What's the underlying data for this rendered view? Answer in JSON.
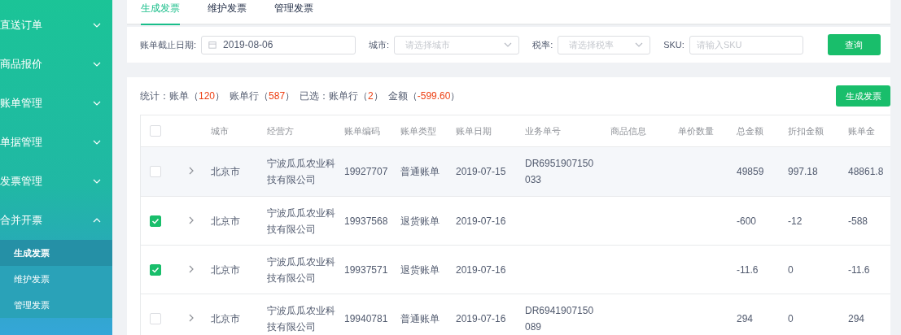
{
  "sidebar": {
    "items": [
      {
        "label": "直送订单",
        "expanded": false
      },
      {
        "label": "商品报价",
        "expanded": false
      },
      {
        "label": "账单管理",
        "expanded": false
      },
      {
        "label": "单据管理",
        "expanded": false
      },
      {
        "label": "发票管理",
        "expanded": false
      },
      {
        "label": "合并开票",
        "expanded": true,
        "children": [
          {
            "label": "生成发票",
            "selected": true
          },
          {
            "label": "维护发票",
            "selected": false
          },
          {
            "label": "管理发票",
            "selected": false
          }
        ]
      }
    ]
  },
  "tabs": [
    {
      "label": "生成发票",
      "selected": true
    },
    {
      "label": "维护发票",
      "selected": false
    },
    {
      "label": "管理发票",
      "selected": false
    }
  ],
  "filters": [
    {
      "kind": "date",
      "label": "账单截止日期:",
      "value": "2019-08-06"
    },
    {
      "kind": "select",
      "label": "城市:",
      "placeholder": "请选择城市"
    },
    {
      "kind": "select",
      "label": "税率:",
      "placeholder": "请选择税率"
    },
    {
      "kind": "text",
      "label": "SKU:",
      "placeholder": "请输入SKU"
    }
  ],
  "query_button": "查询",
  "stats": [
    {
      "text": "统计：账单（",
      "value": "120",
      "end": "）"
    },
    {
      "text": "账单行（",
      "value": "587",
      "end": "）"
    },
    {
      "text": "已选：账单行（",
      "value": "2",
      "end": "）"
    },
    {
      "text": "金额（",
      "value": "-599.60",
      "end": "）"
    }
  ],
  "generate_button": "生成发票",
  "table": {
    "select_all": {
      "checked": false
    },
    "columns": [
      "城市",
      "经营方",
      "账单编码",
      "账单类型",
      "账单日期",
      "业务单号",
      "商品信息",
      "单价数量",
      "总金额",
      "折扣金额",
      "账单金"
    ],
    "rows": [
      {
        "checked": false,
        "highlighted": true,
        "cells": [
          "北京市",
          "宁波瓜瓜农业科技有限公司",
          "19927707",
          "普通账单",
          "2019-07-15",
          "DR6951907150033",
          null,
          null,
          "49859",
          "997.18",
          "48861.8"
        ]
      },
      {
        "checked": true,
        "highlighted": false,
        "cells": [
          "北京市",
          "宁波瓜瓜农业科技有限公司",
          "19937568",
          "退货账单",
          "2019-07-16",
          null,
          null,
          null,
          "-600",
          "-12",
          "-588"
        ]
      },
      {
        "checked": true,
        "highlighted": false,
        "cells": [
          "北京市",
          "宁波瓜瓜农业科技有限公司",
          "19937571",
          "退货账单",
          "2019-07-16",
          null,
          null,
          null,
          "-11.6",
          "0",
          "-11.6"
        ]
      },
      {
        "checked": false,
        "highlighted": false,
        "cells": [
          "北京市",
          "宁波瓜瓜农业科技有限公司",
          "19940781",
          "普通账单",
          "2019-07-16",
          "DR6941907150089",
          null,
          null,
          "294",
          "0",
          "294"
        ]
      }
    ]
  }
}
